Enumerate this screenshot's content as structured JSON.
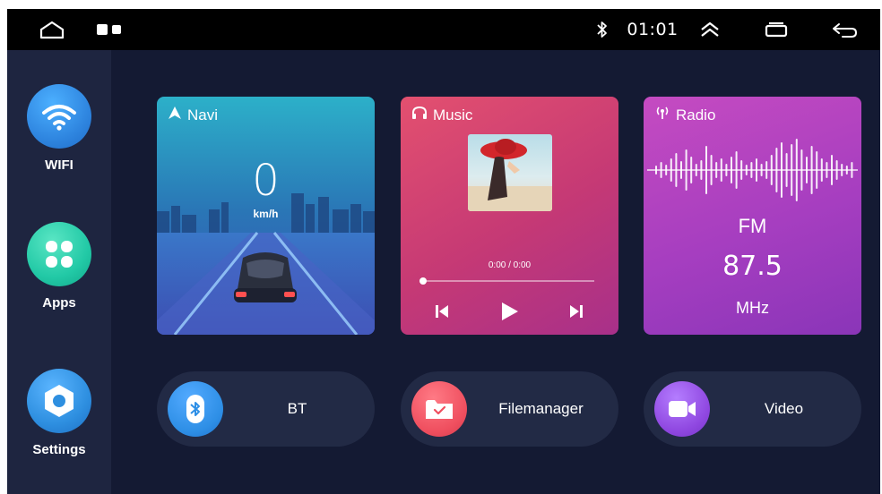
{
  "status_bar": {
    "time": "01:01",
    "icons": [
      "home-icon",
      "recent-apps-icon",
      "bluetooth-icon",
      "expand-icon",
      "window-icon",
      "back-icon"
    ]
  },
  "sidebar": {
    "items": [
      {
        "label": "WIFI",
        "icon": "wifi-icon",
        "color": "#2f86e0"
      },
      {
        "label": "Apps",
        "icon": "apps-icon",
        "color": "#22c9a6"
      },
      {
        "label": "Settings",
        "icon": "settings-icon",
        "color": "#2e8fe0"
      }
    ]
  },
  "cards": {
    "navi": {
      "title": "Navi",
      "speed": "0",
      "speed_unit": "km/h",
      "icon": "navigation-arrow-icon"
    },
    "music": {
      "title": "Music",
      "time": "0:00 / 0:00",
      "progress": 0,
      "icon": "headphones-icon"
    },
    "radio": {
      "title": "Radio",
      "band": "FM",
      "frequency": "87.5",
      "unit": "MHz",
      "icon": "radio-antenna-icon"
    }
  },
  "shortcuts": [
    {
      "label": "BT",
      "icon": "bluetooth-icon",
      "color": "#2e8fe6"
    },
    {
      "label": "Filemanager",
      "icon": "folder-icon",
      "color": "#ef4f5f"
    },
    {
      "label": "Video",
      "icon": "video-camera-icon",
      "color": "#8f47e0"
    }
  ]
}
